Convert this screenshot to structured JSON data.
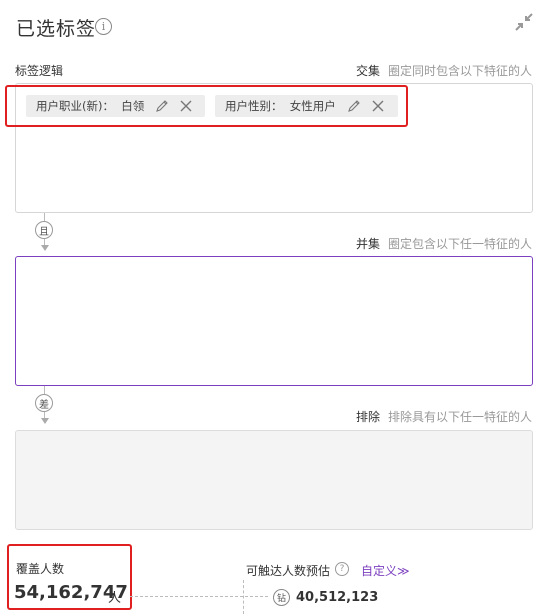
{
  "panel": {
    "title": "已选标签",
    "info_glyph": "i"
  },
  "logic": {
    "label": "标签逻辑"
  },
  "intersection": {
    "mode": "交集",
    "desc": "圈定同时包含以下特征的人",
    "tags": [
      {
        "text": "用户职业(新)：  白领"
      },
      {
        "text": "用户性别：  女性用户"
      }
    ]
  },
  "connector_and": {
    "text": "且"
  },
  "union": {
    "mode": "并集",
    "desc": "圈定包含以下任一特征的人"
  },
  "connector_diff": {
    "text": "差"
  },
  "exclude": {
    "mode": "排除",
    "desc": "排除具有以下任一特征的人"
  },
  "coverage": {
    "label": "覆盖人数",
    "value": "54,162,747",
    "unit": "人"
  },
  "reach": {
    "label": "可触达人数预估",
    "help_glyph": "?",
    "custom_link": "自定义≫",
    "diamond_glyph": "钻",
    "value": "40,512,123"
  },
  "colors": {
    "accent_purple": "#7b3fbf",
    "highlight_red": "#e02020"
  },
  "icons": [
    "info-icon",
    "collapse-icon",
    "pencil-icon",
    "close-icon",
    "help-icon",
    "diamond-icon"
  ]
}
